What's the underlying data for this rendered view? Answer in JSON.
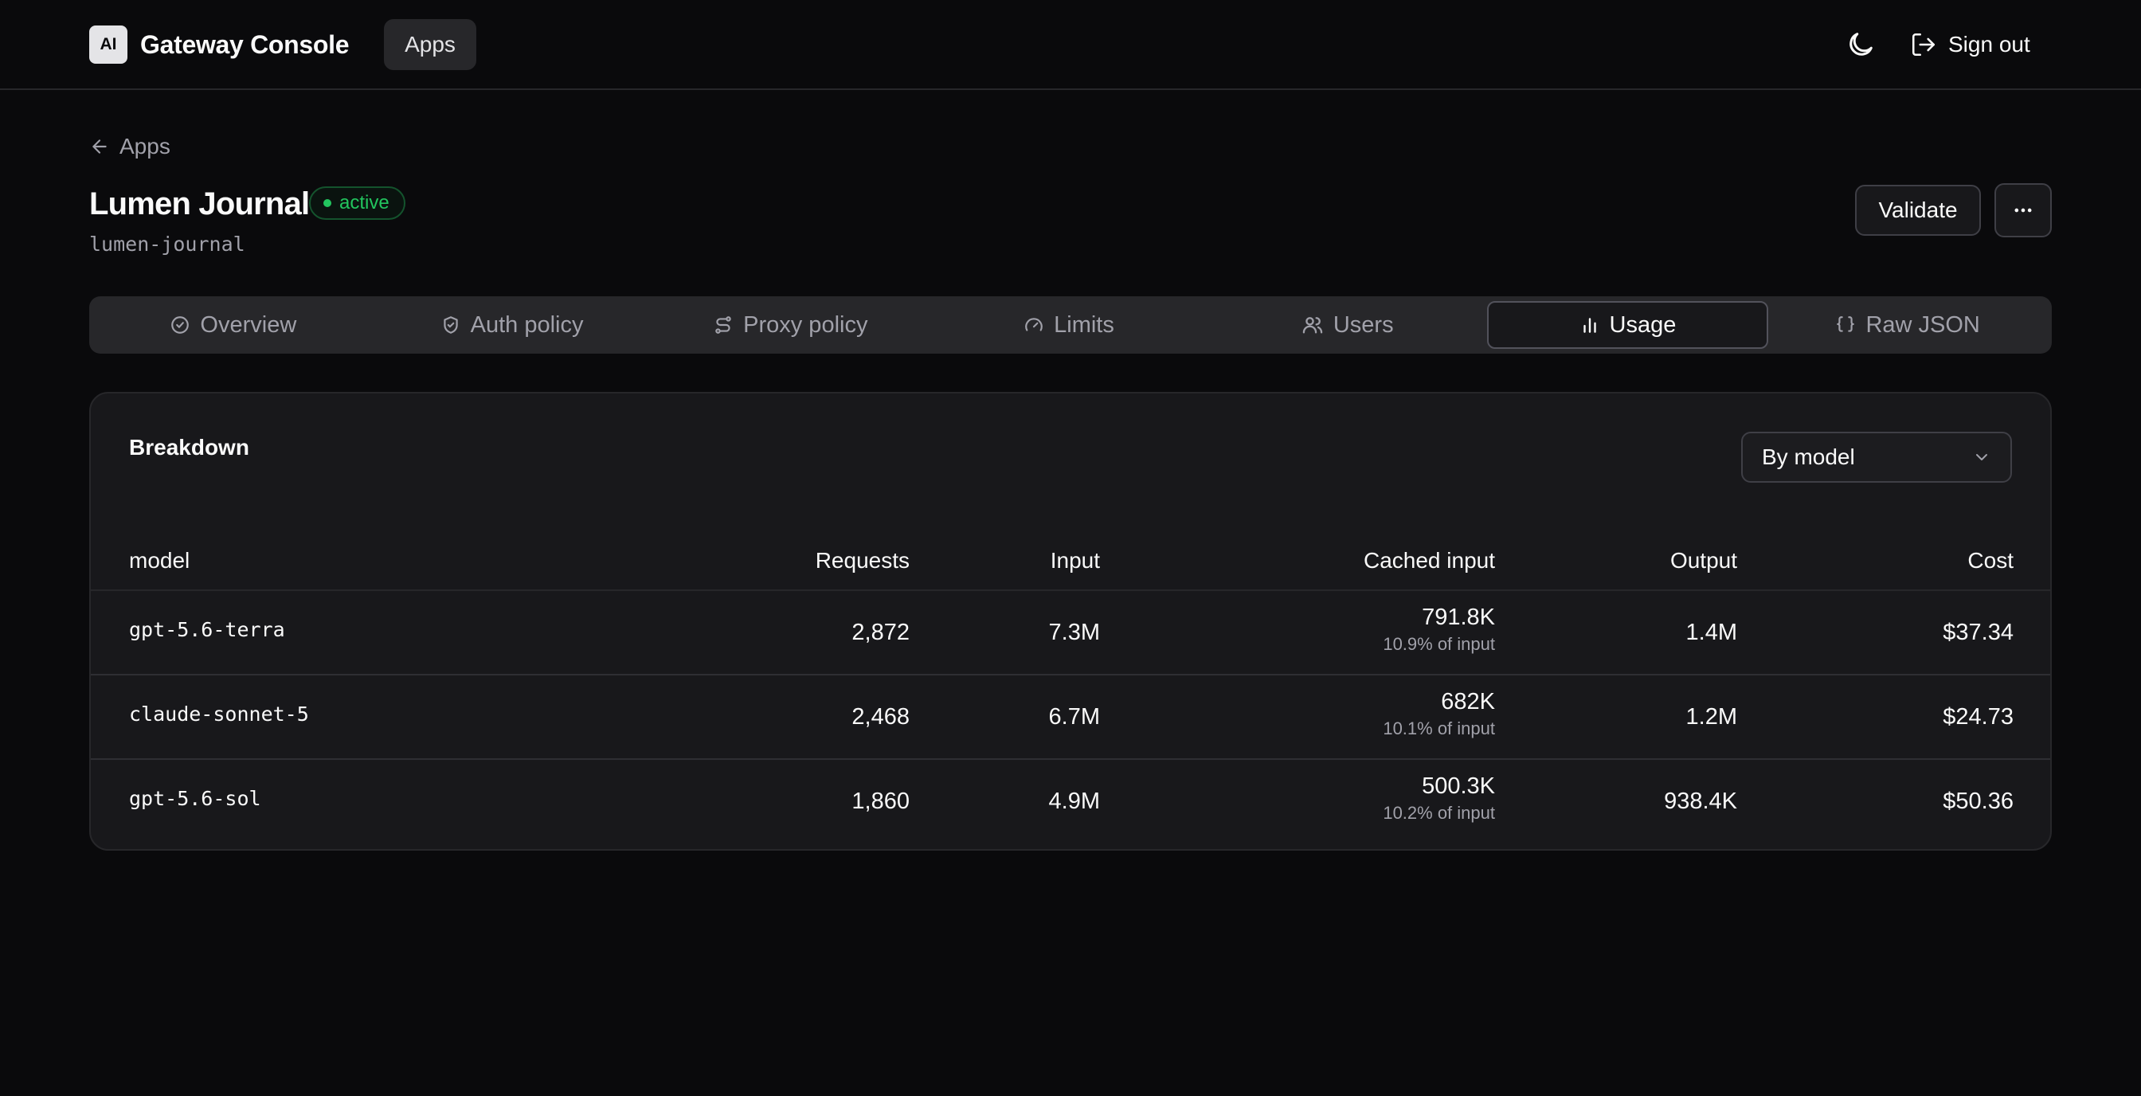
{
  "header": {
    "logo_text": "AI",
    "app_title": "Gateway Console",
    "nav_apps": "Apps",
    "sign_out": "Sign out"
  },
  "back": {
    "label": "Apps"
  },
  "app": {
    "name": "Lumen Journal",
    "status": "active",
    "slug": "lumen-journal",
    "status_color": "#22c55e"
  },
  "actions": {
    "validate": "Validate"
  },
  "tabs": [
    {
      "label": "Overview",
      "icon": "check-circle-icon"
    },
    {
      "label": "Auth policy",
      "icon": "shield-check-icon"
    },
    {
      "label": "Proxy policy",
      "icon": "route-icon"
    },
    {
      "label": "Limits",
      "icon": "gauge-icon"
    },
    {
      "label": "Users",
      "icon": "users-icon"
    },
    {
      "label": "Usage",
      "icon": "bar-chart-icon",
      "active": true
    },
    {
      "label": "Raw JSON",
      "icon": "braces-icon"
    }
  ],
  "breakdown": {
    "title": "Breakdown",
    "group_by": "By model",
    "columns": {
      "model": "model",
      "requests": "Requests",
      "input": "Input",
      "cached": "Cached input",
      "output": "Output",
      "cost": "Cost"
    },
    "rows": [
      {
        "model": "gpt-5.6-terra",
        "requests": "2,872",
        "input": "7.3M",
        "cached": "791.8K",
        "cached_pct": "10.9% of input",
        "output": "1.4M",
        "cost": "$37.34"
      },
      {
        "model": "claude-sonnet-5",
        "requests": "2,468",
        "input": "6.7M",
        "cached": "682K",
        "cached_pct": "10.1% of input",
        "output": "1.2M",
        "cost": "$24.73"
      },
      {
        "model": "gpt-5.6-sol",
        "requests": "1,860",
        "input": "4.9M",
        "cached": "500.3K",
        "cached_pct": "10.2% of input",
        "output": "938.4K",
        "cost": "$50.36"
      }
    ]
  }
}
